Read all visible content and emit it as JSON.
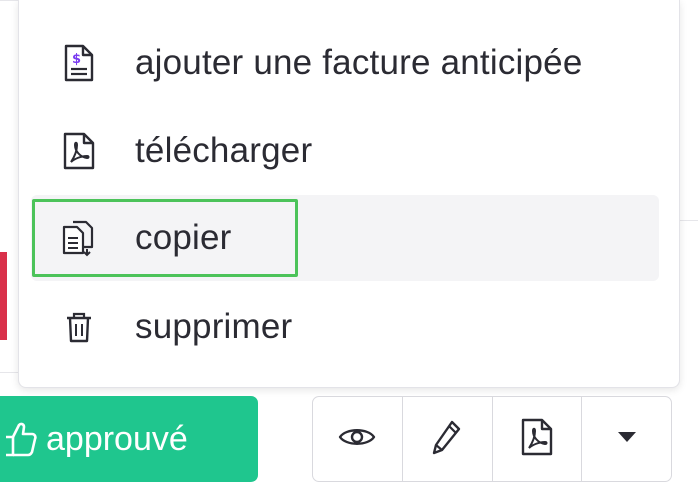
{
  "menu": {
    "items": [
      {
        "label": "ajouter une facture anticipée",
        "icon": "invoice-dollar-icon"
      },
      {
        "label": "télécharger",
        "icon": "pdf-file-icon"
      },
      {
        "label": "copier",
        "icon": "copy-documents-icon"
      },
      {
        "label": "supprimer",
        "icon": "trash-icon"
      }
    ],
    "highlighted_item": "copier"
  },
  "toolbar": {
    "approve_label": "approuvé",
    "approve_icon": "thumbs-up-icon",
    "buttons": [
      {
        "icon": "eye-icon"
      },
      {
        "icon": "pencil-icon"
      },
      {
        "icon": "pdf-file-icon"
      },
      {
        "icon": "caret-down-icon"
      }
    ]
  },
  "colors": {
    "accent_green": "#1fc68e",
    "focus_outline": "#4cc35a",
    "invoice_icon_accent": "#7a3cf0"
  }
}
